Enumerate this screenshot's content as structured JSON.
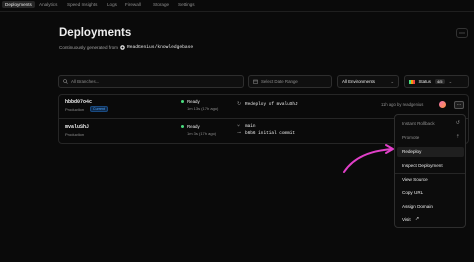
{
  "nav": {
    "tabs": [
      "Deployments",
      "Analytics",
      "Speed Insights",
      "Logs",
      "Firewall",
      "Storage",
      "Settings"
    ]
  },
  "header": {
    "title": "Deployments",
    "subtitle_prefix": "Continuously generated from",
    "repo": "ReadGenius/knowledgebase",
    "more_icon": "ellipsis-icon"
  },
  "filters": {
    "branch_placeholder": "All Branches...",
    "date_range": "Select Date Range",
    "environments": "All Environments",
    "status_label": "Status",
    "status_count": "4/5"
  },
  "deployments": [
    {
      "id": "hbbd07o4c",
      "environment": "Production",
      "current_badge": "Current",
      "status": "Ready",
      "duration": "1m 13s (17h ago)",
      "source": "Redeploy of mvaluShJ",
      "meta": "11h ago by readgenius"
    },
    {
      "id": "mvaluShJ",
      "environment": "Production",
      "status": "Ready",
      "duration": "1m 3s (17h ago)",
      "branch": "main",
      "commit": "b6b6 initial commit",
      "meta": "11h ago by readgenius"
    }
  ],
  "menu": {
    "items": [
      "Instant Rollback",
      "Promote",
      "Redeploy",
      "Inspect Deployment",
      "View Source",
      "Copy URL",
      "Assign Domain",
      "Visit"
    ],
    "highlighted": "Redeploy"
  },
  "colors": {
    "accent": "#e040c8",
    "ready": "#4ade80",
    "link": "#52a8ff"
  }
}
